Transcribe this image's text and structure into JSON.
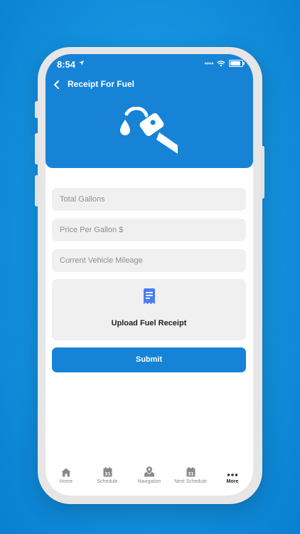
{
  "status_bar": {
    "time": "8:54"
  },
  "header": {
    "title": "Receipt For Fuel"
  },
  "form": {
    "total_gallons_placeholder": "Total Gallons",
    "price_per_gallon_placeholder": "Price Per Gallon $",
    "vehicle_mileage_placeholder": "Current Vehicle Mileage",
    "upload_label": "Upload Fuel Receipt",
    "submit_label": "Submit"
  },
  "tabs": [
    {
      "label": "Home",
      "icon": "home-icon"
    },
    {
      "label": "Schedule",
      "icon": "calendar-icon"
    },
    {
      "label": "Navigation",
      "icon": "map-pin-icon"
    },
    {
      "label": "Next Schedule",
      "icon": "calendar-icon"
    },
    {
      "label": "More",
      "icon": "more-dots-icon",
      "active": true
    }
  ],
  "calendar_day": "31",
  "colors": {
    "primary": "#1683d6",
    "field_bg": "#f0f0f0",
    "upload_icon": "#4a7df0"
  }
}
